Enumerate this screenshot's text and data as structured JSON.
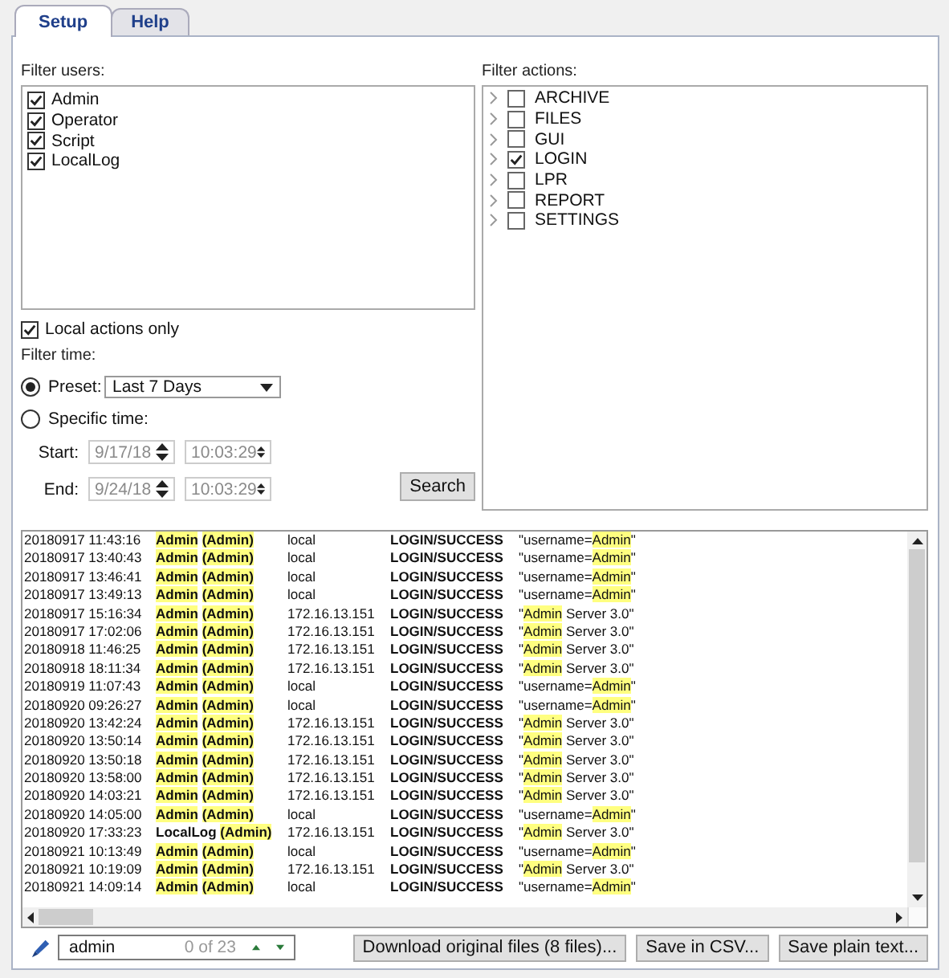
{
  "tabs": [
    {
      "label": "Setup",
      "selected": true
    },
    {
      "label": "Help",
      "selected": false
    }
  ],
  "filter_users": {
    "label": "Filter users:",
    "items": [
      {
        "label": "Admin",
        "checked": true
      },
      {
        "label": "Operator",
        "checked": true
      },
      {
        "label": "Script",
        "checked": true
      },
      {
        "label": "LocalLog",
        "checked": true
      }
    ]
  },
  "local_actions_only": {
    "label": "Local actions only",
    "checked": true
  },
  "filter_time": {
    "label": "Filter time:",
    "preset": {
      "label": "Preset:",
      "selected": true,
      "value": "Last 7 Days"
    },
    "specific": {
      "label": "Specific time:",
      "selected": false
    },
    "start": {
      "label": "Start:",
      "date": "9/17/18",
      "time": "10:03:29",
      "disabled": true
    },
    "end": {
      "label": "End:",
      "date": "9/24/18",
      "time": "10:03:29",
      "disabled": true
    },
    "search_button": "Search"
  },
  "filter_actions": {
    "label": "Filter actions:",
    "items": [
      {
        "label": "ARCHIVE",
        "checked": false
      },
      {
        "label": "FILES",
        "checked": false
      },
      {
        "label": "GUI",
        "checked": false
      },
      {
        "label": "LOGIN",
        "checked": true
      },
      {
        "label": "LPR",
        "checked": false
      },
      {
        "label": "REPORT",
        "checked": false
      },
      {
        "label": "SETTINGS",
        "checked": false
      }
    ]
  },
  "log": {
    "rows": [
      {
        "time": "20180917 11:43:16",
        "user": "Admin",
        "user_match": true,
        "role": "(Admin)",
        "source": "local",
        "action": "LOGIN/SUCCESS",
        "before": "\"username=",
        "match": "Admin",
        "after": "\""
      },
      {
        "time": "20180917 13:40:43",
        "user": "Admin",
        "user_match": true,
        "role": "(Admin)",
        "source": "local",
        "action": "LOGIN/SUCCESS",
        "before": "\"username=",
        "match": "Admin",
        "after": "\""
      },
      {
        "time": "20180917 13:46:41",
        "user": "Admin",
        "user_match": true,
        "role": "(Admin)",
        "source": "local",
        "action": "LOGIN/SUCCESS",
        "before": "\"username=",
        "match": "Admin",
        "after": "\""
      },
      {
        "time": "20180917 13:49:13",
        "user": "Admin",
        "user_match": true,
        "role": "(Admin)",
        "source": "local",
        "action": "LOGIN/SUCCESS",
        "before": "\"username=",
        "match": "Admin",
        "after": "\""
      },
      {
        "time": "20180917 15:16:34",
        "user": "Admin",
        "user_match": true,
        "role": "(Admin)",
        "source": "172.16.13.151",
        "action": "LOGIN/SUCCESS",
        "before": "\"",
        "match": "Admin",
        "after": " Server 3.0\""
      },
      {
        "time": "20180917 17:02:06",
        "user": "Admin",
        "user_match": true,
        "role": "(Admin)",
        "source": "172.16.13.151",
        "action": "LOGIN/SUCCESS",
        "before": "\"",
        "match": "Admin",
        "after": " Server 3.0\""
      },
      {
        "time": "20180918 11:46:25",
        "user": "Admin",
        "user_match": true,
        "role": "(Admin)",
        "source": "172.16.13.151",
        "action": "LOGIN/SUCCESS",
        "before": "\"",
        "match": "Admin",
        "after": " Server 3.0\""
      },
      {
        "time": "20180918 18:11:34",
        "user": "Admin",
        "user_match": true,
        "role": "(Admin)",
        "source": "172.16.13.151",
        "action": "LOGIN/SUCCESS",
        "before": "\"",
        "match": "Admin",
        "after": " Server 3.0\""
      },
      {
        "time": "20180919 11:07:43",
        "user": "Admin",
        "user_match": true,
        "role": "(Admin)",
        "source": "local",
        "action": "LOGIN/SUCCESS",
        "before": "\"username=",
        "match": "Admin",
        "after": "\""
      },
      {
        "time": "20180920 09:26:27",
        "user": "Admin",
        "user_match": true,
        "role": "(Admin)",
        "source": "local",
        "action": "LOGIN/SUCCESS",
        "before": "\"username=",
        "match": "Admin",
        "after": "\""
      },
      {
        "time": "20180920 13:42:24",
        "user": "Admin",
        "user_match": true,
        "role": "(Admin)",
        "source": "172.16.13.151",
        "action": "LOGIN/SUCCESS",
        "before": "\"",
        "match": "Admin",
        "after": " Server 3.0\""
      },
      {
        "time": "20180920 13:50:14",
        "user": "Admin",
        "user_match": true,
        "role": "(Admin)",
        "source": "172.16.13.151",
        "action": "LOGIN/SUCCESS",
        "before": "\"",
        "match": "Admin",
        "after": " Server 3.0\""
      },
      {
        "time": "20180920 13:50:18",
        "user": "Admin",
        "user_match": true,
        "role": "(Admin)",
        "source": "172.16.13.151",
        "action": "LOGIN/SUCCESS",
        "before": "\"",
        "match": "Admin",
        "after": " Server 3.0\""
      },
      {
        "time": "20180920 13:58:00",
        "user": "Admin",
        "user_match": true,
        "role": "(Admin)",
        "source": "172.16.13.151",
        "action": "LOGIN/SUCCESS",
        "before": "\"",
        "match": "Admin",
        "after": " Server 3.0\""
      },
      {
        "time": "20180920 14:03:21",
        "user": "Admin",
        "user_match": true,
        "role": "(Admin)",
        "source": "172.16.13.151",
        "action": "LOGIN/SUCCESS",
        "before": "\"",
        "match": "Admin",
        "after": " Server 3.0\""
      },
      {
        "time": "20180920 14:05:00",
        "user": "Admin",
        "user_match": true,
        "role": "(Admin)",
        "source": "local",
        "action": "LOGIN/SUCCESS",
        "before": "\"username=",
        "match": "Admin",
        "after": "\""
      },
      {
        "time": "20180920 17:33:23",
        "user": "LocalLog",
        "user_match": false,
        "role": "(Admin)",
        "source": "172.16.13.151",
        "action": "LOGIN/SUCCESS",
        "before": "\"",
        "match": "Admin",
        "after": " Server 3.0\""
      },
      {
        "time": "20180921 10:13:49",
        "user": "Admin",
        "user_match": true,
        "role": "(Admin)",
        "source": "local",
        "action": "LOGIN/SUCCESS",
        "before": "\"username=",
        "match": "Admin",
        "after": "\""
      },
      {
        "time": "20180921 10:19:09",
        "user": "Admin",
        "user_match": true,
        "role": "(Admin)",
        "source": "172.16.13.151",
        "action": "LOGIN/SUCCESS",
        "before": "\"",
        "match": "Admin",
        "after": " Server 3.0\""
      },
      {
        "time": "20180921 14:09:14",
        "user": "Admin",
        "user_match": true,
        "role": "(Admin)",
        "source": "local",
        "action": "LOGIN/SUCCESS",
        "before": "\"username=",
        "match": "Admin",
        "after": "\""
      }
    ]
  },
  "find_bar": {
    "value": "admin",
    "count": "0 of 23"
  },
  "buttons": [
    "Download original files (8 files)...",
    "Save in CSV...",
    "Save plain text..."
  ]
}
